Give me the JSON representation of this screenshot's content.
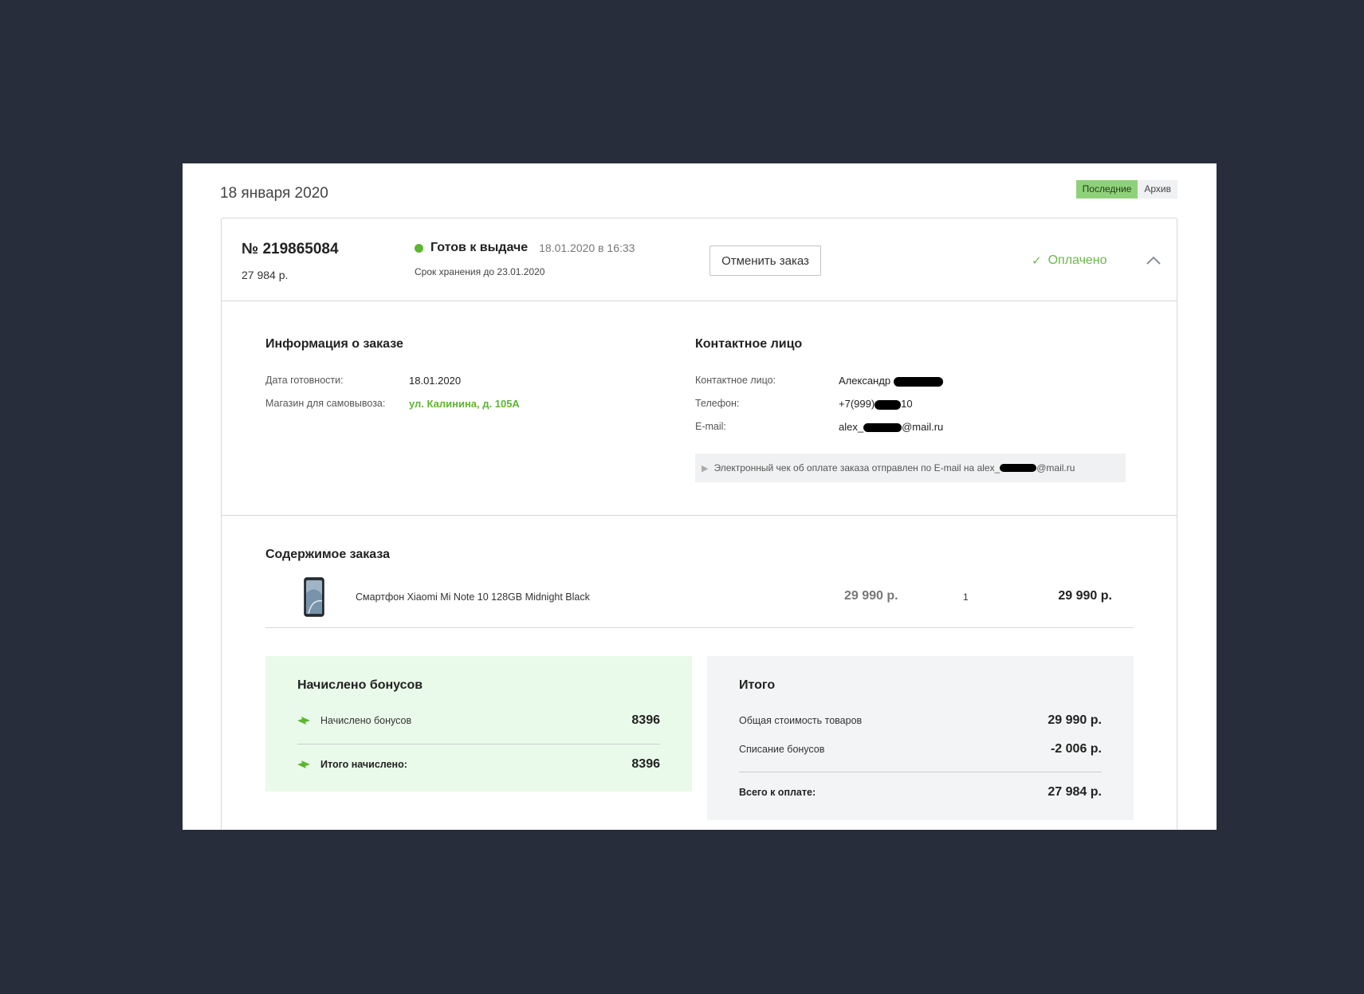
{
  "header": {
    "date": "18 января 2020",
    "tabs": [
      {
        "label": "Последние",
        "active": true
      },
      {
        "label": "Архив",
        "active": false
      }
    ]
  },
  "order": {
    "number": "№ 219865084",
    "sum": "27 984 р.",
    "status": "Готов к выдаче",
    "status_time": "18.01.2020 в 16:33",
    "storage": "Срок хранения до 23.01.2020",
    "cancel_label": "Отменить заказ",
    "payment_status": "Оплачено",
    "status_color": "#5cb630",
    "accent_color": "#8fd17a"
  },
  "order_info": {
    "title": "Информация о заказе",
    "ready_date_label": "Дата готовности:",
    "ready_date_value": "18.01.2020",
    "store_label": "Магазин для самовывоза:",
    "store_value": "ул. Калинина, д. 105А"
  },
  "contact": {
    "title": "Контактное лицо",
    "person_label": "Контактное лицо:",
    "person_value": "Александр",
    "phone_label": "Телефон:",
    "phone_prefix": "+7(999)",
    "phone_suffix": "10",
    "email_label": "E-mail:",
    "email_prefix": "alex_",
    "email_suffix": "@mail.ru",
    "receipt_prefix": "Электронный чек об оплате заказа отправлен по E-mail на alex_",
    "receipt_suffix": "@mail.ru"
  },
  "contents": {
    "title": "Содержимое заказа",
    "items": [
      {
        "name": "Смартфон Xiaomi Mi Note 10 128GB Midnight Black",
        "price": "29 990 р.",
        "qty": "1",
        "total": "29 990 р."
      }
    ]
  },
  "bonuses": {
    "title": "Начислено бонусов",
    "row_label": "Начислено бонусов",
    "row_value": "8396",
    "total_label": "Итого начислено:",
    "total_value": "8396"
  },
  "summary": {
    "title": "Итого",
    "goods_label": "Общая стоимость товаров",
    "goods_value": "29 990 р.",
    "bonus_label": "Списание бонусов",
    "bonus_value": "-2 006 р.",
    "total_label": "Всего к оплате:",
    "total_value": "27 984 р."
  }
}
